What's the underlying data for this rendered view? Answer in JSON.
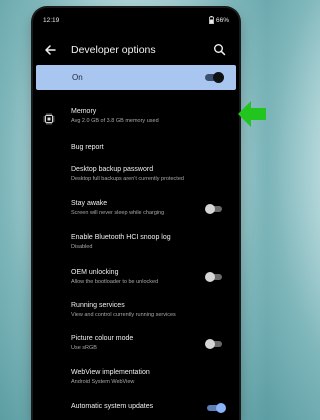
{
  "status_bar": {
    "time": "12:19",
    "battery": "66%"
  },
  "app_bar": {
    "title": "Developer options"
  },
  "master_switch": {
    "label": "On",
    "state": "on"
  },
  "items": [
    {
      "title": "Memory",
      "subtitle": "Avg 2.0 GB of 3.8 GB memory used",
      "icon": "memory-chip-icon"
    },
    {
      "title": "Bug report"
    },
    {
      "title": "Desktop backup password",
      "subtitle": "Desktop full backups aren't currently protected"
    },
    {
      "title": "Stay awake",
      "subtitle": "Screen will never sleep while charging",
      "toggle": "off"
    },
    {
      "title": "Enable Bluetooth HCI snoop log",
      "subtitle": "Disabled"
    },
    {
      "title": "OEM unlocking",
      "subtitle": "Allow the bootloader to be unlocked",
      "toggle": "off"
    },
    {
      "title": "Running services",
      "subtitle": "View and control currently running services"
    },
    {
      "title": "Picture colour mode",
      "subtitle": "Use sRGB",
      "toggle": "off"
    },
    {
      "title": "WebView implementation",
      "subtitle": "Android System WebView"
    },
    {
      "title": "Automatic system updates",
      "toggle": "on"
    }
  ],
  "colors": {
    "accent_green_arrow": "#22c41e",
    "master_switch_bg": "#a9c6f1",
    "screen_bg": "#000000"
  }
}
